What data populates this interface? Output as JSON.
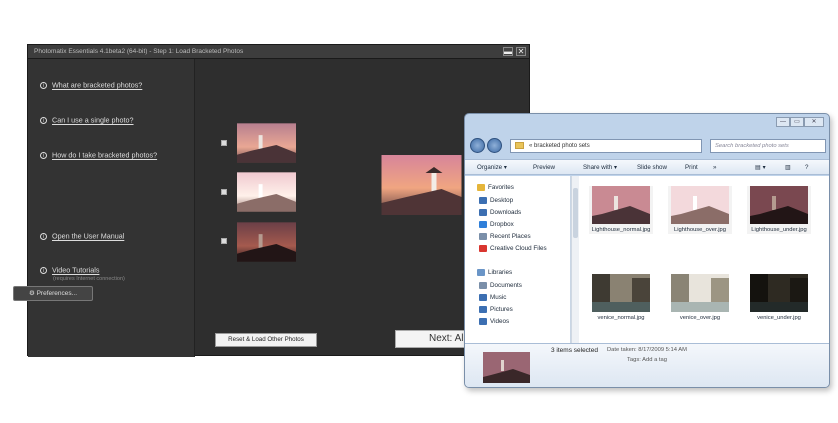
{
  "photomatix": {
    "title": "Photomatix Essentials  4.1beta2 (64-bit) - Step 1: Load Bracketed Photos",
    "min_label": "▬",
    "close_label": "✕",
    "help_links": [
      {
        "label": "What are bracketed photos?"
      },
      {
        "label": "Can I use a single photo?"
      },
      {
        "label": "How do I take bracketed photos?"
      },
      {
        "label": "Open the User Manual"
      },
      {
        "label": "Video Tutorials",
        "sublabel": "(requires Internet connection)"
      }
    ],
    "preferences_label": "Preferences...",
    "reset_label": "Reset & Load Other Photos",
    "next_label": "Next: Align & Merge",
    "photos": [
      {
        "checked": true
      },
      {
        "checked": true
      },
      {
        "checked": true
      }
    ]
  },
  "explorer": {
    "title_controls": [
      "—",
      "▭",
      "✕"
    ],
    "address": "« bracketed photo sets",
    "search_placeholder": "Search bracketed photo sets",
    "toolbar": [
      "Organize ▾",
      "Preview",
      "Share with ▾",
      "Slide show",
      "Print",
      "»"
    ],
    "nav": [
      {
        "label": "Favorites",
        "color": "#e5b53a"
      },
      {
        "label": "Desktop",
        "color": "#3c6fb2"
      },
      {
        "label": "Downloads",
        "color": "#3c6fb2"
      },
      {
        "label": "Dropbox",
        "color": "#2f7fd9"
      },
      {
        "label": "Recent Places",
        "color": "#7a8fa9"
      },
      {
        "label": "Creative Cloud Files",
        "color": "#d9362f"
      },
      {
        "label": "Libraries",
        "color": "#6a95c7"
      },
      {
        "label": "Documents",
        "color": "#7a8fa9"
      },
      {
        "label": "Music",
        "color": "#3c6fb2"
      },
      {
        "label": "Pictures",
        "color": "#3c6fb2"
      },
      {
        "label": "Videos",
        "color": "#3c6fb2"
      }
    ],
    "files": [
      {
        "name": "Lighthouse_normal.jpg"
      },
      {
        "name": "Lighthouse_over.jpg"
      },
      {
        "name": "Lighthouse_under.jpg"
      },
      {
        "name": "venice_normal.jpg"
      },
      {
        "name": "venice_over.jpg"
      },
      {
        "name": "venice_under.jpg"
      }
    ],
    "status": {
      "count": "3 items selected",
      "date": "Date taken: 8/17/2009 5:14 AM",
      "tags": "Tags: Add a tag"
    }
  }
}
